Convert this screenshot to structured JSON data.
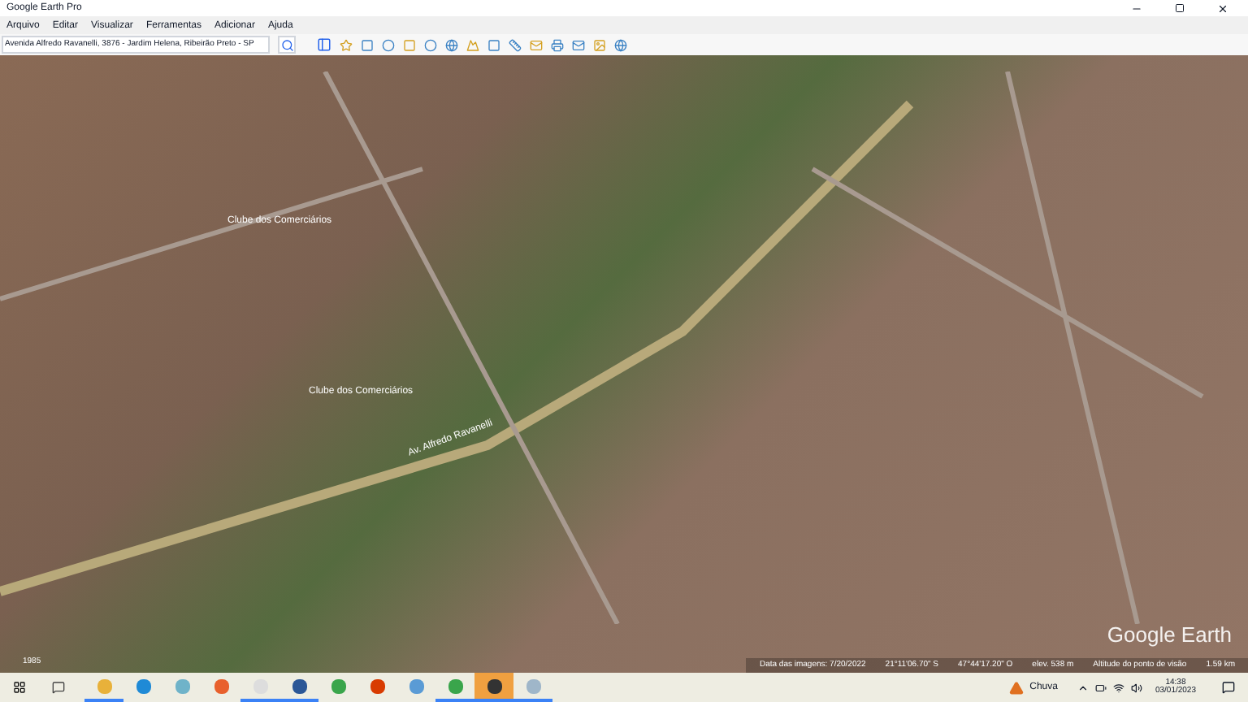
{
  "window": {
    "title": "Google Earth Pro"
  },
  "menu": [
    "Arquivo",
    "Editar",
    "Visualizar",
    "Ferramentas",
    "Adicionar",
    "Ajuda"
  ],
  "search": {
    "value": "Avenida Alfredo Ravanelli, 3876 - Jardim Helena, Ribeirão Preto - SP"
  },
  "map_labels": [
    {
      "text": "Clube dos Comerciários",
      "kind": "place"
    },
    {
      "text": "Clube dos Comerciários",
      "kind": "place"
    },
    {
      "text": "Av. Alfredo Ravanelli",
      "kind": "road"
    }
  ],
  "map_logo": "Google Earth",
  "year": "1985",
  "status_bar": [
    "Data das imagens: 7/20/2022",
    "21°11'06.70\" S",
    "47°44'17.20\" O",
    "elev. 538 m",
    "Altitude do ponto de visão",
    "1.59 km"
  ],
  "taskbar": {
    "weather": "Chuva",
    "time": "14:38",
    "date": "03/01/2023",
    "apps": [
      {
        "kind": "files",
        "active": true
      },
      {
        "kind": "edge",
        "active": false
      },
      {
        "kind": "notes",
        "active": false
      },
      {
        "kind": "firefox",
        "active": false
      },
      {
        "kind": "doc",
        "active": true
      },
      {
        "kind": "word",
        "active": true
      },
      {
        "kind": "chrome",
        "active": false
      },
      {
        "kind": "office",
        "active": false
      },
      {
        "kind": "mail",
        "active": false
      },
      {
        "kind": "chrome",
        "active": true
      },
      {
        "kind": "earth",
        "active": true,
        "selected": true
      },
      {
        "kind": "paint",
        "active": true
      }
    ]
  }
}
